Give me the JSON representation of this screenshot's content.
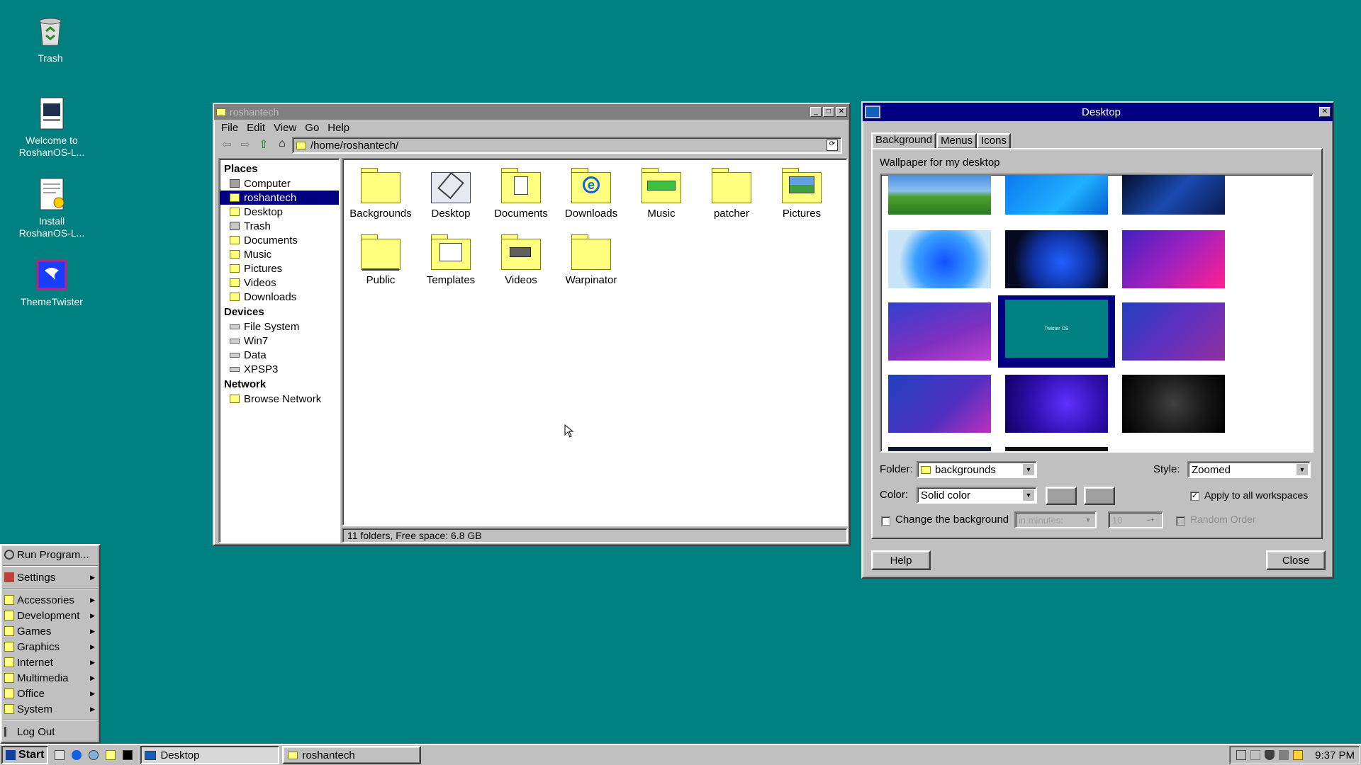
{
  "desktop_icons": [
    {
      "label": "Trash"
    },
    {
      "label": "Welcome to\nRoshanOS-L..."
    },
    {
      "label": "Install\nRoshanOS-L..."
    },
    {
      "label": "ThemeTwister"
    }
  ],
  "file_manager": {
    "title": "roshantech",
    "menu": [
      "File",
      "Edit",
      "View",
      "Go",
      "Help"
    ],
    "path": "/home/roshantech/",
    "places_heading": "Places",
    "places": [
      "Computer",
      "roshantech",
      "Desktop",
      "Trash",
      "Documents",
      "Music",
      "Pictures",
      "Videos",
      "Downloads"
    ],
    "devices_heading": "Devices",
    "devices": [
      "File System",
      "Win7",
      "Data",
      "XPSP3"
    ],
    "network_heading": "Network",
    "network": [
      "Browse Network"
    ],
    "folders": [
      "Backgrounds",
      "Desktop",
      "Documents",
      "Downloads",
      "Music",
      "patcher",
      "Pictures",
      "Public",
      "Templates",
      "Videos",
      "Warpinator"
    ],
    "status": "11 folders, Free space: 6.8 GB"
  },
  "desktop_dialog": {
    "title": "Desktop",
    "tabs": [
      "Background",
      "Menus",
      "Icons"
    ],
    "wallpaper_label": "Wallpaper for my desktop",
    "thumb_text": "Twister OS",
    "folder_label": "Folder:",
    "folder_value": "backgrounds",
    "style_label": "Style:",
    "style_value": "Zoomed",
    "color_label": "Color:",
    "color_value": "Solid color",
    "apply_all": "Apply to all workspaces",
    "change_bg": "Change the background",
    "interval_value": "in minutes:",
    "minutes_value": "10",
    "random_order": "Random Order",
    "help": "Help",
    "close": "Close"
  },
  "start_menu": {
    "run": "Run Program...",
    "settings": "Settings",
    "items": [
      "Accessories",
      "Development",
      "Games",
      "Graphics",
      "Internet",
      "Multimedia",
      "Office",
      "System"
    ],
    "logout": "Log Out"
  },
  "taskbar": {
    "start": "Start",
    "tasks": [
      "Desktop",
      "roshantech"
    ],
    "clock": "9:37 PM"
  }
}
